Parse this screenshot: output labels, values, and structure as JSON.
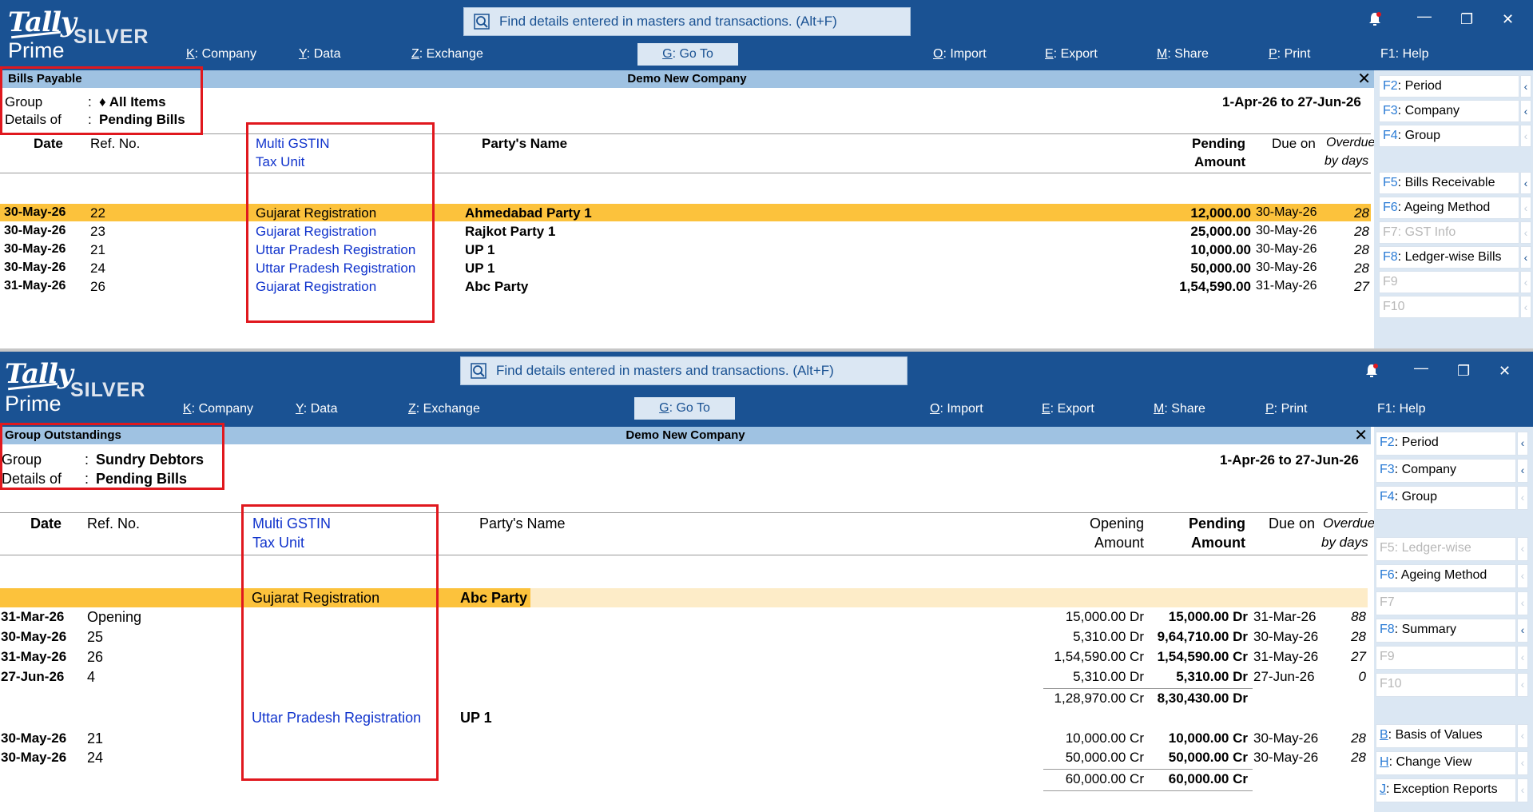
{
  "app": {
    "logo_tally": "Tally",
    "logo_prime": "Prime",
    "logo_edition": "SILVER",
    "search_placeholder": "Find details entered in masters and transactions. (Alt+F)",
    "window_controls": [
      "bell-icon",
      "minimize-icon",
      "restore-icon",
      "close-icon"
    ],
    "menu": [
      {
        "key": "K",
        "label": "Company"
      },
      {
        "key": "Y",
        "label": "Data"
      },
      {
        "key": "Z",
        "label": "Exchange"
      },
      {
        "key": "G",
        "label": "Go To"
      },
      {
        "key": "O",
        "label": "Import"
      },
      {
        "key": "E",
        "label": "Export"
      },
      {
        "key": "M",
        "label": "Share"
      },
      {
        "key": "P",
        "label": "Print"
      },
      {
        "key": "F1",
        "label": "Help"
      }
    ],
    "colors": {
      "header": "#1a5293",
      "titlebar": "#9fc2e2",
      "highlight": "#fcc23c",
      "accent_key": "#2a7bd5",
      "link_blue": "#1033cc",
      "annotation_red": "#e0181e"
    }
  },
  "top": {
    "report_title": "Bills Payable",
    "company": "Demo New Company",
    "group_label": "Group",
    "group_value": "♦ All Items",
    "details_label": "Details of",
    "details_value": "Pending Bills",
    "period": "1-Apr-26 to 27-Jun-26",
    "columns": {
      "date": "Date",
      "ref": "Ref. No.",
      "gstin_1": "Multi GSTIN",
      "gstin_2": "Tax Unit",
      "party": "Party's Name",
      "pending_1": "Pending",
      "pending_2": "Amount",
      "due": "Due on",
      "overdue_1": "Overdue",
      "overdue_2": "by days"
    },
    "rows": [
      {
        "date": "30-May-26",
        "ref": "22",
        "gstin": "Gujarat Registration",
        "party": "Ahmedabad Party 1",
        "amount": "12,000.00",
        "due": "30-May-26",
        "overdue": "28"
      },
      {
        "date": "30-May-26",
        "ref": "23",
        "gstin": "Gujarat Registration",
        "party": "Rajkot Party 1",
        "amount": "25,000.00",
        "due": "30-May-26",
        "overdue": "28"
      },
      {
        "date": "30-May-26",
        "ref": "21",
        "gstin": "Uttar Pradesh Registration",
        "party": "UP 1",
        "amount": "10,000.00",
        "due": "30-May-26",
        "overdue": "28"
      },
      {
        "date": "30-May-26",
        "ref": "24",
        "gstin": "Uttar Pradesh Registration",
        "party": "UP 1",
        "amount": "50,000.00",
        "due": "30-May-26",
        "overdue": "28"
      },
      {
        "date": "31-May-26",
        "ref": "26",
        "gstin": "Gujarat Registration",
        "party": "Abc Party",
        "amount": "1,54,590.00",
        "due": "31-May-26",
        "overdue": "27"
      }
    ],
    "side_buttons": [
      {
        "key": "F2",
        "label": "Period",
        "enabled": true,
        "arrow": true
      },
      {
        "key": "F3",
        "label": "Company",
        "enabled": true,
        "arrow": true
      },
      {
        "key": "F4",
        "label": "Group",
        "enabled": true,
        "arrow": false
      },
      {
        "key": "F5",
        "label": "Bills Receivable",
        "enabled": true,
        "arrow": true
      },
      {
        "key": "F6",
        "label": "Ageing Method",
        "enabled": true,
        "arrow": false
      },
      {
        "key": "F7",
        "label": "GST Info",
        "enabled": false,
        "arrow": false
      },
      {
        "key": "F8",
        "label": "Ledger-wise Bills",
        "enabled": true,
        "arrow": true
      },
      {
        "key": "F9",
        "label": "",
        "enabled": false,
        "arrow": false
      },
      {
        "key": "F10",
        "label": "",
        "enabled": false,
        "arrow": false
      }
    ]
  },
  "bottom": {
    "report_title": "Group Outstandings",
    "company": "Demo New Company",
    "group_label": "Group",
    "group_value": "Sundry Debtors",
    "details_label": "Details of",
    "details_value": "Pending Bills",
    "period": "1-Apr-26 to 27-Jun-26",
    "columns": {
      "date": "Date",
      "ref": "Ref. No.",
      "gstin_1": "Multi GSTIN",
      "gstin_2": "Tax Unit",
      "party": "Party's Name",
      "opening_1": "Opening",
      "opening_2": "Amount",
      "pending_1": "Pending",
      "pending_2": "Amount",
      "due": "Due on",
      "overdue_1": "Overdue",
      "overdue_2": "by days"
    },
    "groups": [
      {
        "gstin": "Gujarat Registration",
        "party": "Abc Party",
        "rows": [
          {
            "date": "31-Mar-26",
            "ref": "Opening",
            "opening": "15,000.00 Dr",
            "pending": "15,000.00 Dr",
            "due": "31-Mar-26",
            "overdue": "88"
          },
          {
            "date": "30-May-26",
            "ref": "25",
            "opening": "5,310.00 Dr",
            "pending": "9,64,710.00 Dr",
            "due": "30-May-26",
            "overdue": "28"
          },
          {
            "date": "31-May-26",
            "ref": "26",
            "opening": "1,54,590.00 Cr",
            "pending": "1,54,590.00 Cr",
            "due": "31-May-26",
            "overdue": "27"
          },
          {
            "date": "27-Jun-26",
            "ref": "4",
            "opening": "5,310.00 Dr",
            "pending": "5,310.00 Dr",
            "due": "27-Jun-26",
            "overdue": "0"
          }
        ],
        "total_opening": "1,28,970.00 Cr",
        "total_pending": "8,30,430.00 Dr"
      },
      {
        "gstin": "Uttar Pradesh Registration",
        "party": "UP 1",
        "rows": [
          {
            "date": "30-May-26",
            "ref": "21",
            "opening": "10,000.00 Cr",
            "pending": "10,000.00 Cr",
            "due": "30-May-26",
            "overdue": "28"
          },
          {
            "date": "30-May-26",
            "ref": "24",
            "opening": "50,000.00 Cr",
            "pending": "50,000.00 Cr",
            "due": "30-May-26",
            "overdue": "28"
          }
        ],
        "total_opening": "60,000.00 Cr",
        "total_pending": "60,000.00 Cr"
      }
    ],
    "side_buttons": [
      {
        "key": "F2",
        "label": "Period",
        "enabled": true,
        "arrow": true
      },
      {
        "key": "F3",
        "label": "Company",
        "enabled": true,
        "arrow": true
      },
      {
        "key": "F4",
        "label": "Group",
        "enabled": true,
        "arrow": false
      },
      {
        "key": "F5",
        "label": "Ledger-wise",
        "enabled": false,
        "arrow": false
      },
      {
        "key": "F6",
        "label": "Ageing Method",
        "enabled": true,
        "arrow": false
      },
      {
        "key": "F7",
        "label": "",
        "enabled": false,
        "arrow": false
      },
      {
        "key": "F8",
        "label": "Summary",
        "enabled": true,
        "arrow": true
      },
      {
        "key": "F9",
        "label": "",
        "enabled": false,
        "arrow": false
      },
      {
        "key": "F10",
        "label": "",
        "enabled": false,
        "arrow": false
      },
      {
        "key": "B",
        "label": "Basis of Values",
        "enabled": true,
        "arrow": false
      },
      {
        "key": "H",
        "label": "Change View",
        "enabled": true,
        "arrow": false
      },
      {
        "key": "J",
        "label": "Exception Reports",
        "enabled": true,
        "arrow": false
      }
    ]
  }
}
